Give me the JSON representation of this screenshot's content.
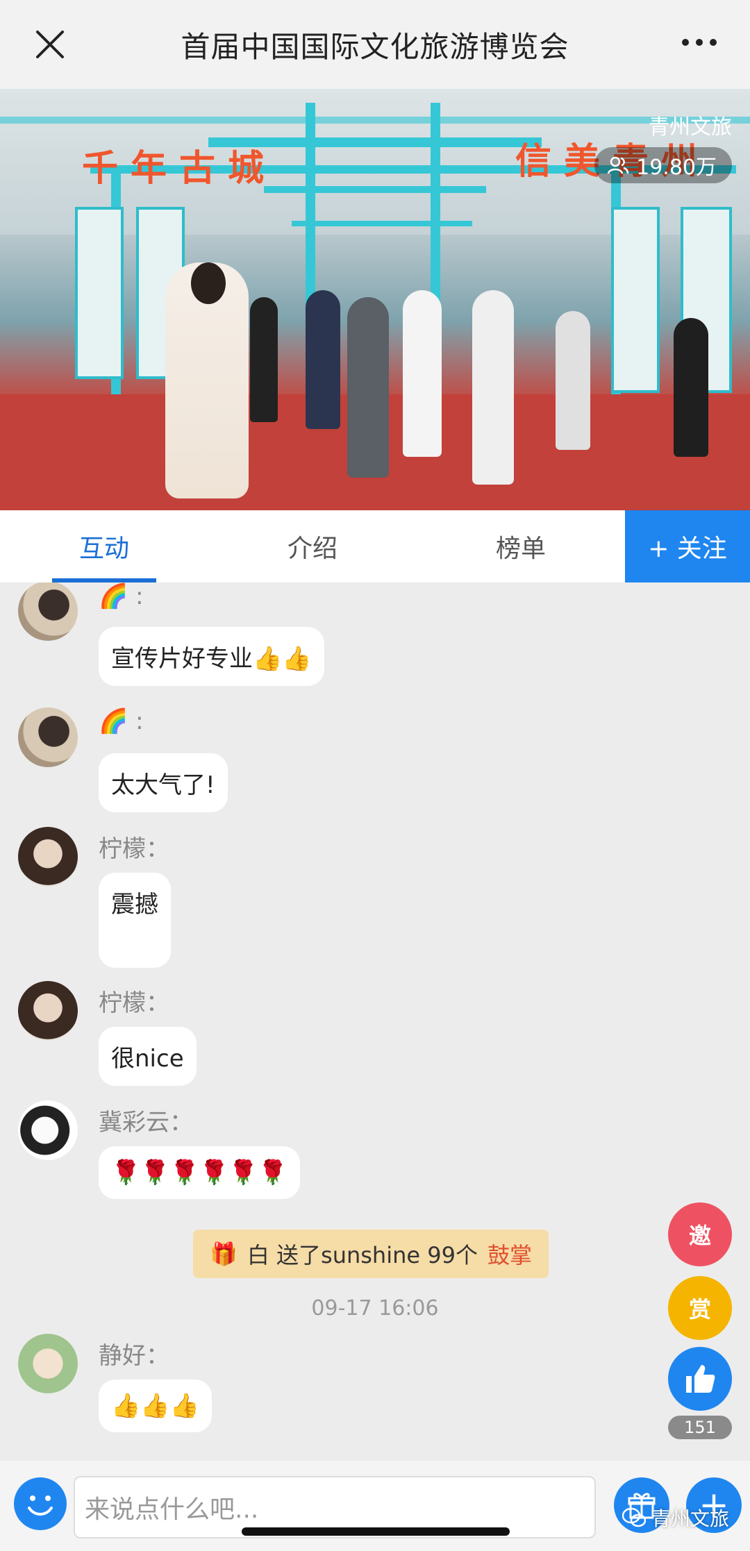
{
  "header": {
    "title": "首届中国国际文化旅游博览会"
  },
  "video": {
    "channel": "青州文旅",
    "viewers": "19.80万",
    "banner_left": "千年古城",
    "banner_right": "信美青州"
  },
  "tabs": [
    {
      "label": "互动"
    },
    {
      "label": "介绍"
    },
    {
      "label": "榜单"
    }
  ],
  "follow_label": "+ 关注",
  "messages": [
    {
      "name": "🌈 :",
      "text": "宣传片好专业👍👍"
    },
    {
      "name": "🌈 :",
      "text": "太大气了!"
    },
    {
      "name": "柠檬：",
      "text": "震撼"
    },
    {
      "name": "柠檬：",
      "text": "很nice"
    },
    {
      "name": "冀彩云：",
      "text": "🌹🌹🌹🌹🌹🌹"
    },
    {
      "name": "静好：",
      "text": "👍👍👍"
    }
  ],
  "gift": {
    "icon": "🎁",
    "text": "白 送了sunshine 99个",
    "item": "鼓掌"
  },
  "timestamp": "09-17 16:06",
  "side": {
    "invite": "邀",
    "reward": "赏",
    "like_count": "151"
  },
  "input": {
    "placeholder": "来说点什么吧..."
  },
  "watermark": "青州文旅",
  "colors": {
    "accent": "#1f86f0",
    "tab_active": "#1a6fd6",
    "gift_bg": "#f6dca7",
    "gift_highlight": "#e04e2d"
  }
}
